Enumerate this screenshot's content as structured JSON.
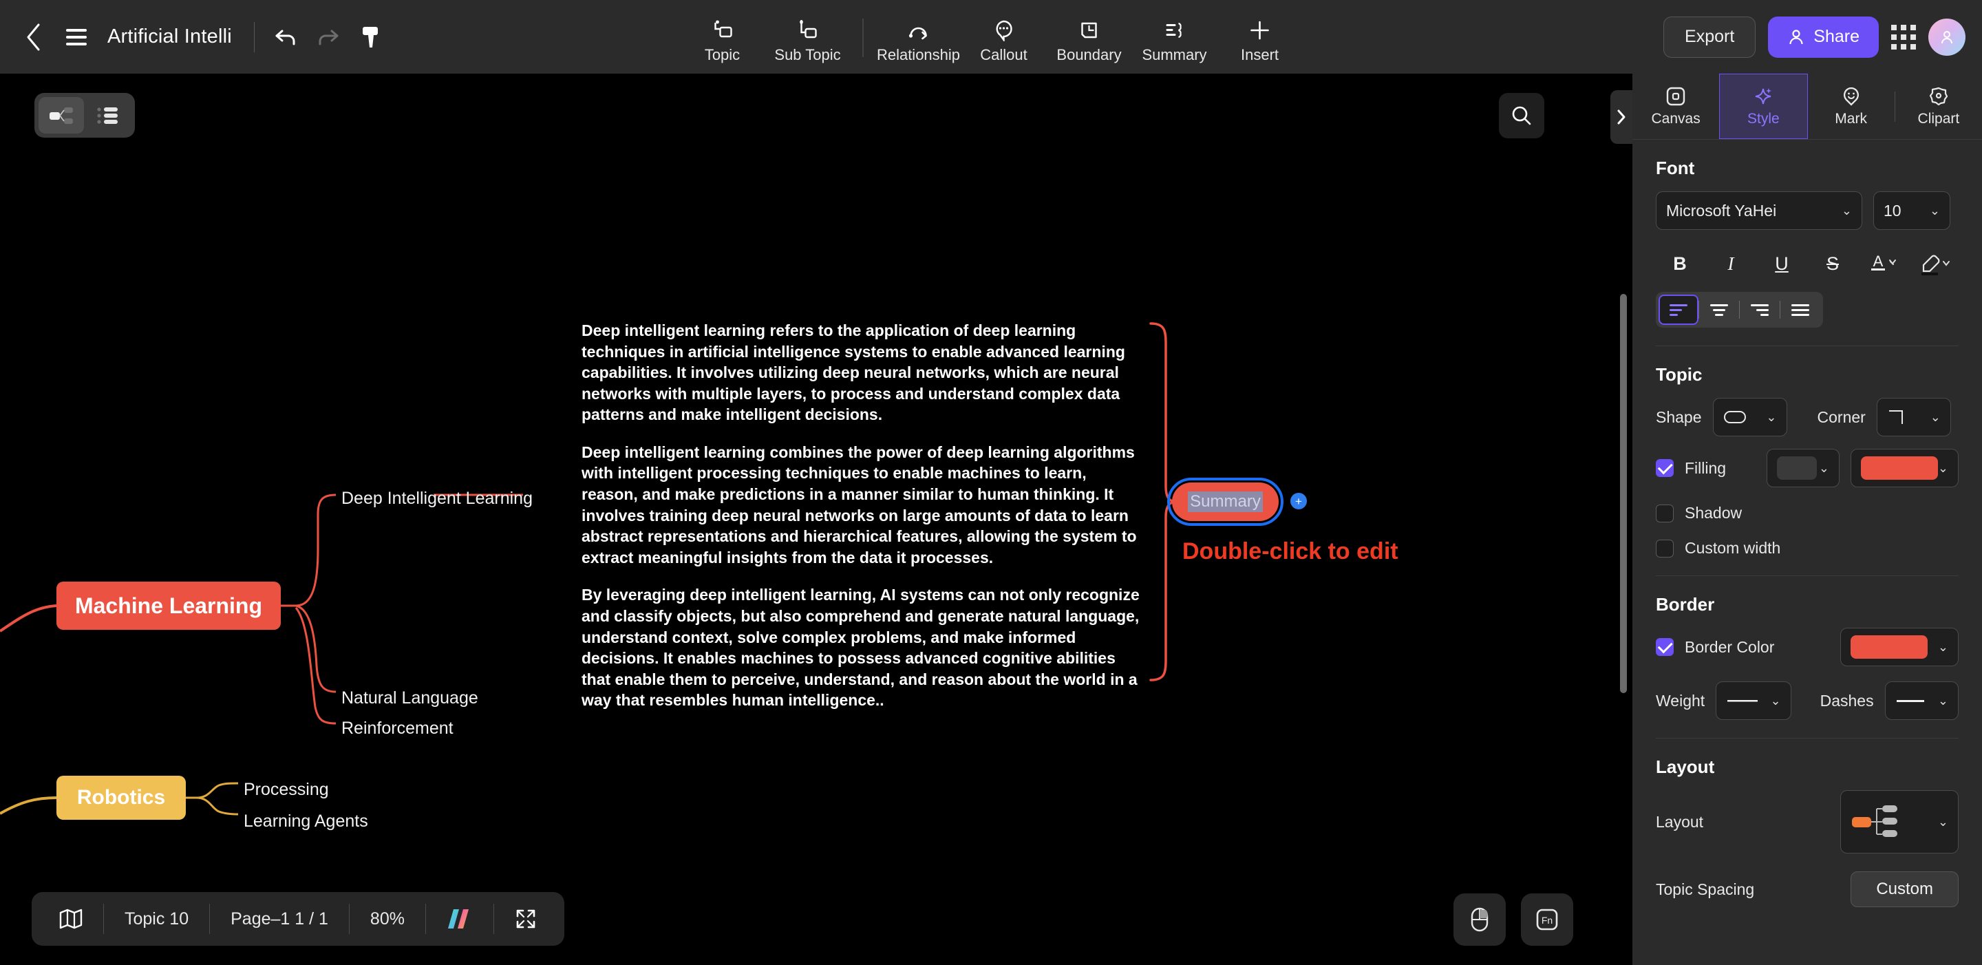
{
  "header": {
    "back_icon": "chevron-left-icon",
    "menu_icon": "hamburger-menu-icon",
    "title": "Artificial Intelli",
    "undo_icon": "undo-icon",
    "redo_icon": "redo-icon",
    "format_painter_icon": "format-painter-icon",
    "tools": [
      {
        "label": "Topic",
        "icon": "topic-icon"
      },
      {
        "label": "Sub Topic",
        "icon": "sub-topic-icon"
      },
      {
        "label": "Relationship",
        "icon": "relationship-icon"
      },
      {
        "label": "Callout",
        "icon": "callout-icon"
      },
      {
        "label": "Boundary",
        "icon": "boundary-icon"
      },
      {
        "label": "Summary",
        "icon": "summary-icon"
      },
      {
        "label": "Insert",
        "icon": "plus-icon"
      }
    ],
    "export_label": "Export",
    "share_label": "Share",
    "share_icon": "person-icon",
    "apps_icon": "grid-apps-icon",
    "avatar_icon": "user-avatar"
  },
  "canvas": {
    "view_toggle": {
      "mindmap_icon": "mindmap-view-icon",
      "outline_icon": "outline-view-icon"
    },
    "search_icon": "search-icon",
    "collapse_icon": "chevron-right-icon",
    "nodes": {
      "machine_learning": "Machine Learning",
      "robotics": "Robotics",
      "deep_intelligent_learning": "Deep Intelligent Learning",
      "natural_language": "Natural Language",
      "reinforcement": "Reinforcement",
      "processing": "Processing",
      "learning_agents": "Learning Agents"
    },
    "colors": {
      "machine_learning_fill": "#ec5242",
      "robotics_fill": "#f1c055",
      "branch_red": "#ec5242",
      "branch_yellow": "#e0a93b",
      "selection_blue": "#1b6ef3",
      "edit_hint_red": "#ef3b23"
    },
    "body_paragraphs": [
      "Deep intelligent learning refers to the application of deep learning techniques in artificial intelligence systems to enable advanced learning capabilities. It involves utilizing deep neural networks, which are neural networks with multiple layers, to process and understand complex data patterns and make intelligent decisions.",
      "Deep intelligent learning combines the power of deep learning algorithms with intelligent processing techniques to enable machines to learn, reason, and make predictions in a manner similar to human thinking. It involves training deep neural networks on large amounts of data to learn abstract representations and hierarchical features, allowing the system to extract meaningful insights from the data it processes.",
      "By leveraging deep intelligent learning, AI systems can not only recognize and classify objects, but also comprehend and generate natural language, understand context, solve complex problems, and make informed decisions. It enables machines to possess advanced cognitive abilities that enable them to perceive, understand, and reason about the world in a way that resembles human intelligence.."
    ],
    "summary_node_label": "Summary",
    "add_button_label": "+",
    "edit_hint": "Double-click to edit"
  },
  "statusbar": {
    "map_icon": "map-icon",
    "topic_count": "Topic 10",
    "page": "Page–1  1 / 1",
    "zoom": "80%",
    "brand_icon": "brand-logo-icon",
    "fullscreen_icon": "fullscreen-icon"
  },
  "fabs": {
    "mouse_icon": "mouse-icon",
    "fn_icon": "fn-key-icon"
  },
  "panel": {
    "tabs": [
      {
        "label": "Canvas",
        "icon": "canvas-icon",
        "active": false
      },
      {
        "label": "Style",
        "icon": "sparkle-icon",
        "active": true
      },
      {
        "label": "Mark",
        "icon": "mark-pin-icon",
        "active": false
      },
      {
        "label": "Clipart",
        "icon": "clipart-icon",
        "active": false
      }
    ],
    "font": {
      "title": "Font",
      "family": "Microsoft YaHei",
      "size": "10",
      "bold": "B",
      "italic": "I",
      "underline": "U",
      "strike": "S",
      "text_color_icon": "text-color-icon",
      "highlight_icon": "highlighter-icon",
      "align_options": [
        "align-left",
        "align-center",
        "align-right",
        "align-justify"
      ],
      "align_active": "align-left"
    },
    "topic": {
      "title": "Topic",
      "shape_label": "Shape",
      "shape_value": "rounded-rect-shape",
      "corner_label": "Corner",
      "corner_value": "square-corner",
      "filling_label": "Filling",
      "filling_checked": true,
      "filling_gradient_swatch": "#3a3a3a",
      "filling_color": "#ec5242",
      "shadow_label": "Shadow",
      "shadow_checked": false,
      "custom_width_label": "Custom width",
      "custom_width_checked": false
    },
    "border": {
      "title": "Border",
      "border_color_label": "Border Color",
      "border_color_checked": true,
      "border_color": "#ec5242",
      "weight_label": "Weight",
      "weight_value": "solid-thin-line",
      "dashes_label": "Dashes",
      "dashes_value": "solid-line"
    },
    "layout": {
      "title": "Layout",
      "layout_label": "Layout",
      "layout_value": "right-tree-layout",
      "topic_spacing_label": "Topic Spacing",
      "topic_spacing_value": "Custom"
    }
  }
}
